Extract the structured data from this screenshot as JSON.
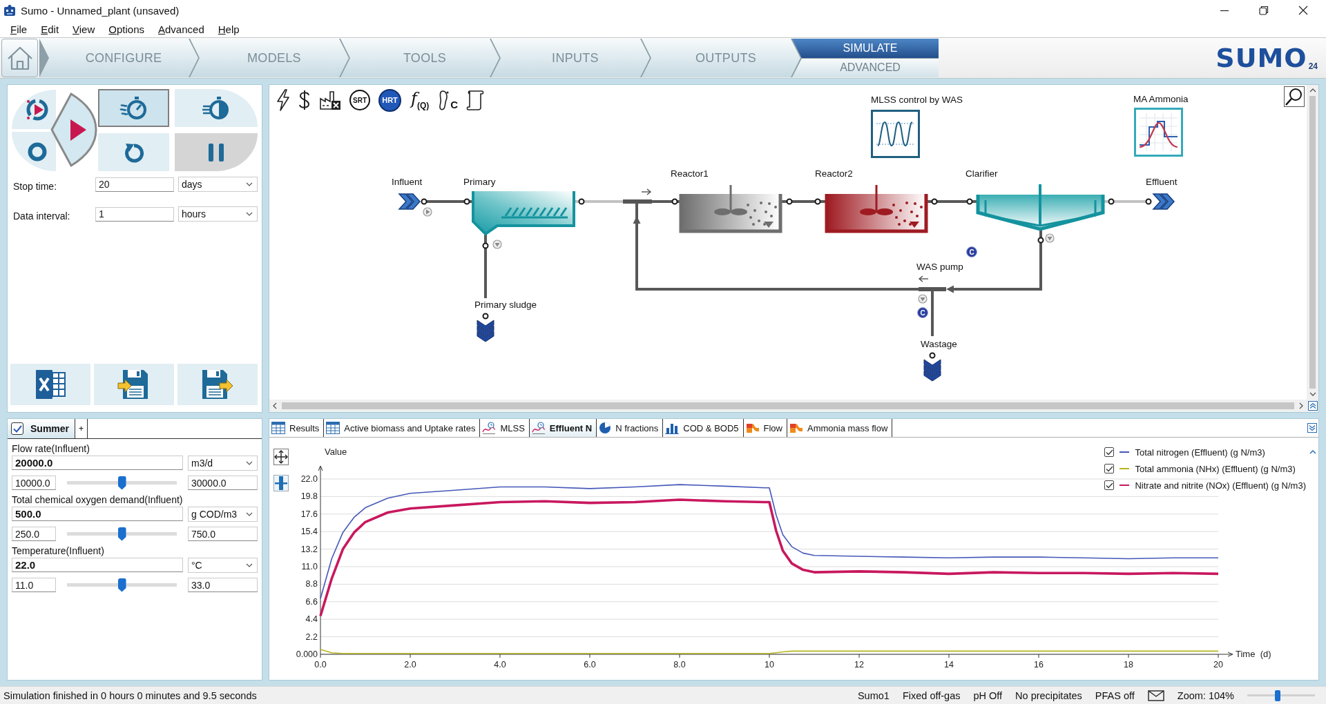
{
  "window": {
    "title": "Sumo - Unnamed_plant (unsaved)"
  },
  "menu": [
    "File",
    "Edit",
    "View",
    "Options",
    "Advanced",
    "Help"
  ],
  "nav_tabs": [
    {
      "label": "CONFIGURE",
      "selected": false
    },
    {
      "label": "MODELS",
      "selected": false
    },
    {
      "label": "TOOLS",
      "selected": false
    },
    {
      "label": "INPUTS",
      "selected": false
    },
    {
      "label": "OUTPUTS",
      "selected": false
    }
  ],
  "mode_tabs": [
    {
      "label": "SIMULATE",
      "selected": true
    },
    {
      "label": "ADVANCED",
      "selected": false
    }
  ],
  "logo": {
    "wordmark": "SUMO",
    "version": "24"
  },
  "run_panel": {
    "controls": [
      {
        "kind": "loop",
        "selected": false,
        "disabled": false
      },
      {
        "kind": "stop",
        "selected": false,
        "disabled": false
      },
      {
        "kind": "play",
        "selected": false,
        "disabled": false
      },
      {
        "kind": "step",
        "selected": true,
        "disabled": false
      },
      {
        "kind": "finish",
        "selected": false,
        "disabled": false
      },
      {
        "kind": "reset",
        "selected": false,
        "disabled": false
      },
      {
        "kind": "pause",
        "selected": false,
        "disabled": true
      }
    ],
    "fields": [
      {
        "label": "Stop time:",
        "value": "20",
        "unit": "days"
      },
      {
        "label": "Data interval:",
        "value": "1",
        "unit": "hours"
      }
    ],
    "file_buttons": [
      {
        "kind": "spreadsheet"
      },
      {
        "kind": "load"
      },
      {
        "kind": "save"
      }
    ]
  },
  "scenario": {
    "tab": {
      "label": "Summer",
      "checked": true
    },
    "add_tab": "+"
  },
  "parameters": [
    {
      "label": "Flow rate(Influent)",
      "value": "20000.0",
      "unit": "m3/d",
      "min": "10000.0",
      "max": "30000.0",
      "level": 0.5
    },
    {
      "label": "Total chemical oxygen demand(Influent)",
      "value": "500.0",
      "unit": "g COD/m3",
      "min": "250.0",
      "max": "750.0",
      "level": 0.5
    },
    {
      "label": "Temperature(Influent)",
      "value": "22.0",
      "unit": "°C",
      "min": "11.0",
      "max": "33.0",
      "level": 0.5
    }
  ],
  "flowsheet": {
    "tools": [
      {
        "kind": "power"
      },
      {
        "kind": "cost"
      },
      {
        "kind": "emissions"
      },
      {
        "kind": "ring",
        "label": "SRT"
      },
      {
        "kind": "disc",
        "label": "HRT"
      },
      {
        "kind": "function",
        "label": "*f*$_{(Q)}$"
      },
      {
        "kind": "footprint",
        "label": "C"
      },
      {
        "kind": "scroll"
      }
    ],
    "controllers": [
      {
        "label": "MLSS control by WAS",
        "kind": "wave"
      },
      {
        "label": "MA Ammonia",
        "kind": "peak"
      }
    ],
    "units": [
      {
        "kind": "influent",
        "label": "Influent"
      },
      {
        "kind": "primary",
        "label": "Primary"
      },
      {
        "kind": "reactor",
        "label": "Reactor1",
        "color": "#6e6e6e"
      },
      {
        "kind": "reactor",
        "label": "Reactor2",
        "color": "#9e1b22"
      },
      {
        "kind": "clarifier",
        "label": "Clarifier"
      },
      {
        "kind": "effluent",
        "label": "Effluent"
      },
      {
        "kind": "sludge",
        "label": "Primary sludge"
      },
      {
        "kind": "pump",
        "label": "WAS pump"
      },
      {
        "kind": "sludge",
        "label": "Wastage"
      }
    ],
    "badges": [
      "C",
      "C"
    ]
  },
  "results": {
    "tabs": [
      {
        "label": "Results",
        "kind": "table",
        "selected": false
      },
      {
        "label": "Active biomass and Uptake rates",
        "kind": "table",
        "selected": false
      },
      {
        "label": "MLSS",
        "kind": "line",
        "selected": false
      },
      {
        "label": "Effluent N",
        "kind": "line",
        "selected": true
      },
      {
        "label": "N fractions",
        "kind": "pie",
        "selected": false
      },
      {
        "label": "COD & BOD5",
        "kind": "bar",
        "selected": false
      },
      {
        "label": "Flow",
        "kind": "sankey",
        "selected": false
      },
      {
        "label": "Ammonia mass flow",
        "kind": "sankey",
        "selected": false
      }
    ],
    "legend_checks": [
      {
        "checked": true
      },
      {
        "checked": true
      },
      {
        "checked": true
      }
    ],
    "chart_data": {
      "type": "line",
      "ylabel": "Value",
      "xlabel": "Time  (d)",
      "x": [
        0,
        0.25,
        0.5,
        0.75,
        1,
        1.5,
        2,
        3,
        4,
        5,
        6,
        7,
        8,
        9,
        9.9,
        10,
        10.15,
        10.3,
        10.5,
        10.75,
        11,
        12,
        13,
        14,
        15,
        16,
        17,
        18,
        19,
        20
      ],
      "series": [
        {
          "name": "Total nitrogen (Effluent) (g N/m3)",
          "color": "#4557b8",
          "values": [
            7.0,
            12.0,
            15.3,
            17.2,
            18.4,
            19.6,
            20.2,
            20.6,
            21.0,
            21.0,
            20.8,
            21.0,
            21.3,
            21.1,
            20.9,
            20.9,
            17.5,
            15.0,
            13.5,
            12.7,
            12.4,
            12.3,
            12.2,
            12.1,
            12.2,
            12.2,
            12.1,
            12.0,
            12.1,
            12.1
          ]
        },
        {
          "name": "Total ammonia (NHx) (Effluent) (g N/m3)",
          "color": "#b5b51f",
          "values": [
            0.6,
            0.2,
            0.1,
            0.1,
            0.1,
            0.1,
            0.1,
            0.1,
            0.1,
            0.1,
            0.1,
            0.1,
            0.1,
            0.1,
            0.1,
            0.1,
            0.2,
            0.3,
            0.4,
            0.4,
            0.4,
            0.4,
            0.4,
            0.4,
            0.4,
            0.4,
            0.4,
            0.4,
            0.4,
            0.4
          ]
        },
        {
          "name": "Nitrate and nitrite (NOx) (Effluent) (g N/m3)",
          "color": "#c8185e",
          "values": [
            4.8,
            9.5,
            13.2,
            15.3,
            16.6,
            17.8,
            18.3,
            18.7,
            19.1,
            19.2,
            19.0,
            19.1,
            19.4,
            19.2,
            19.1,
            19.1,
            15.5,
            13.0,
            11.4,
            10.6,
            10.3,
            10.4,
            10.3,
            10.1,
            10.3,
            10.2,
            10.2,
            10.1,
            10.2,
            10.1
          ]
        }
      ],
      "xlim": [
        0,
        20
      ],
      "ylim": [
        0,
        22
      ],
      "xticks": [
        {
          "value": 0,
          "label": "0.0"
        },
        {
          "value": 2,
          "label": "2.0"
        },
        {
          "value": 4,
          "label": "4.0"
        },
        {
          "value": 6,
          "label": "6.0"
        },
        {
          "value": 8,
          "label": "8.0"
        },
        10,
        12,
        14,
        16,
        18,
        20
      ],
      "yticks": [
        {
          "value": 0,
          "label": "0.000"
        },
        {
          "value": 2.2,
          "label": "2.2"
        },
        {
          "value": 4.4,
          "label": "4.4"
        },
        {
          "value": 6.6,
          "label": "6.6"
        },
        {
          "value": 8.8,
          "label": "8.8"
        },
        {
          "value": 11,
          "label": "11.0"
        },
        {
          "value": 13.2,
          "label": "13.2"
        },
        {
          "value": 15.4,
          "label": "15.4"
        },
        {
          "value": 17.6,
          "label": "17.6"
        },
        {
          "value": 19.8,
          "label": "19.8"
        },
        {
          "value": 22,
          "label": "22.0"
        }
      ],
      "grid": true,
      "legend": true
    }
  },
  "status_bar": {
    "message": "Simulation finished in 0 hours 0 minutes and 9.5 seconds",
    "items": [
      "Sumo1",
      "Fixed off-gas",
      "pH Off",
      "No precipitates",
      "PFAS off"
    ],
    "zoom": "Zoom: 104%",
    "zoom_slider": {
      "level": 0.44
    }
  }
}
